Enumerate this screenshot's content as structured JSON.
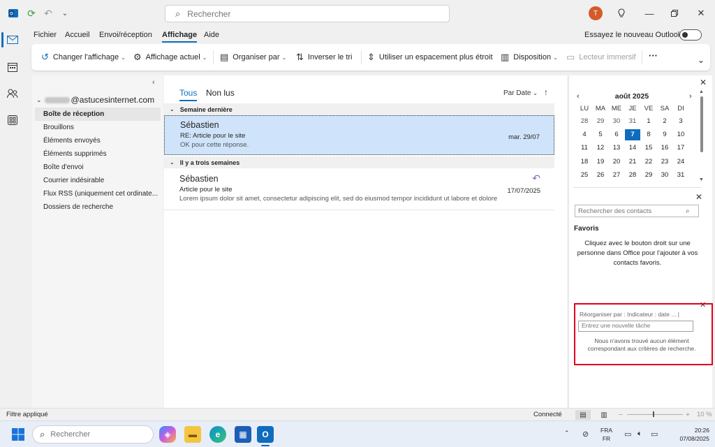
{
  "titlebar": {
    "search_placeholder": "Rechercher",
    "avatar_initial": "T"
  },
  "menu": {
    "tabs": [
      "Fichier",
      "Accueil",
      "Envoi/réception",
      "Affichage",
      "Aide"
    ],
    "active_tab": "Affichage",
    "try_new_outlook": "Essayez le nouveau Outlook",
    "try_new_toggle_on": false
  },
  "ribbon": {
    "change_view": "Changer l'affichage",
    "current_view": "Affichage actuel",
    "organize_by": "Organiser par",
    "reverse_sort": "Inverser le tri",
    "compact_spacing": "Utiliser un espacement plus étroit",
    "layout": "Disposition",
    "immersive_reader": "Lecteur immersif",
    "more": "···"
  },
  "folders": {
    "account_suffix": "@astucesinternet.com",
    "items": [
      "Boîte de réception",
      "Brouillons",
      "Éléments envoyés",
      "Éléments supprimés",
      "Boîte d'envoi",
      "Courrier indésirable",
      "Flux RSS (uniquement cet ordinate...",
      "Dossiers de recherche"
    ],
    "selected_index": 0
  },
  "messages": {
    "tab_all": "Tous",
    "tab_unread": "Non lus",
    "sort_by": "Par Date",
    "groups": [
      {
        "header": "Semaine dernière",
        "items": [
          {
            "sender": "Sébastien",
            "subject": "RE: Article pour le site",
            "preview": "OK pour cette réponse.",
            "date": "mar. 29/07",
            "selected": true,
            "replied": false
          }
        ]
      },
      {
        "header": "Il y a trois semaines",
        "items": [
          {
            "sender": "Sébastien",
            "subject": "Article pour le site",
            "preview": "Lorem ipsum dolor sit amet, consectetur adipiscing elit, sed do eiusmod tempor incididunt ut labore et dolore",
            "date": "17/07/2025",
            "selected": false,
            "replied": true
          }
        ]
      }
    ]
  },
  "calendar": {
    "month": "août 2025",
    "weekdays": [
      "LU",
      "MA",
      "ME",
      "JE",
      "VE",
      "SA",
      "DI"
    ],
    "weeks": [
      [
        "28",
        "29",
        "30",
        "31",
        "1",
        "2",
        "3"
      ],
      [
        "4",
        "5",
        "6",
        "7",
        "8",
        "9",
        "10"
      ],
      [
        "11",
        "12",
        "13",
        "14",
        "15",
        "16",
        "17"
      ],
      [
        "18",
        "19",
        "20",
        "21",
        "22",
        "23",
        "24"
      ],
      [
        "25",
        "26",
        "27",
        "28",
        "29",
        "30",
        "31"
      ]
    ],
    "today": "7"
  },
  "contacts": {
    "search_placeholder": "Rechercher des contacts",
    "favorites_title": "Favoris",
    "favorites_hint": "Cliquez avec le bouton droit sur une personne dans Office pour l'ajouter à vos contacts favoris."
  },
  "tasks": {
    "reorganize": "Réorganiser par : Indicateur : date ... |",
    "new_task_placeholder": "Entrez une nouvelle tâche",
    "empty_message": "Nous n'avons trouvé aucun élément correspondant aux critères de recherche."
  },
  "status": {
    "filter": "Filtre appliqué",
    "connection": "Connecté",
    "zoom": "10 %"
  },
  "taskbar": {
    "search_placeholder": "Rechercher",
    "lang_line1": "FRA",
    "lang_line2": "FR",
    "time": "20:26",
    "date": "07/08/2025"
  },
  "colors": {
    "accent": "#0f6cbd",
    "selected_message": "#cfe4fa",
    "highlight_box": "#e0001b",
    "replied_icon": "#8a5ec4"
  }
}
